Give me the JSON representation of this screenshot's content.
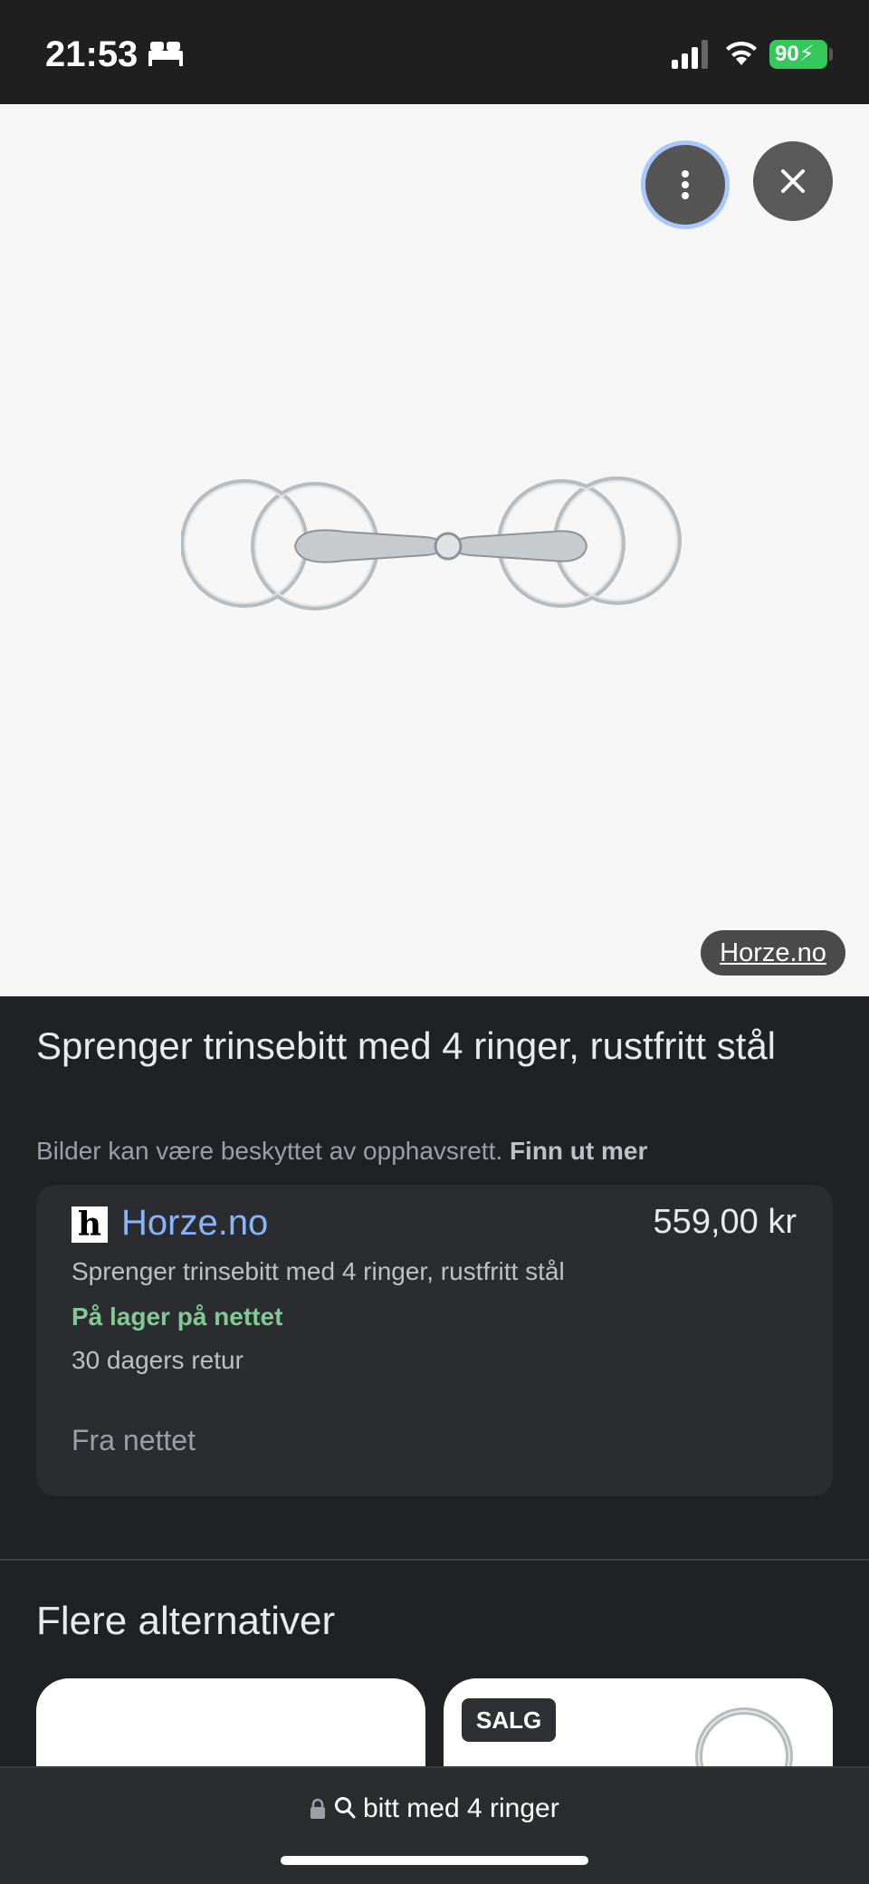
{
  "status_bar": {
    "time": "21:53",
    "battery": "90"
  },
  "image_viewer": {
    "source_label": "Horze.no"
  },
  "product": {
    "title": "Sprenger trinsebitt med 4 ringer, rustfritt stål",
    "copyright_text": "Bilder kan være beskyttet av opphavsrett.",
    "copyright_link": "Finn ut mer"
  },
  "offer": {
    "store_logo": "h",
    "store_name": "Horze.no",
    "price": "559,00 kr",
    "description": "Sprenger trinsebitt med 4 ringer, rustfritt stål",
    "stock": "På lager på nettet",
    "returns": "30 dagers retur",
    "source": "Fra nettet"
  },
  "alternatives": {
    "title": "Flere alternativer",
    "items": [
      {
        "badge": ""
      },
      {
        "badge": "SALG"
      }
    ]
  },
  "browser": {
    "url_text": "bitt med 4 ringer"
  },
  "icons": {
    "more": "more-vert-icon",
    "close": "close-icon",
    "lock": "lock-icon",
    "search": "search-icon",
    "bed": "bed-icon",
    "signal": "signal-icon",
    "wifi": "wifi-icon"
  }
}
